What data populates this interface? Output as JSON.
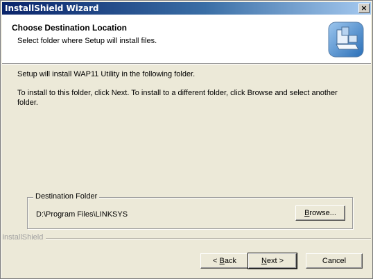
{
  "window": {
    "title": "InstallShield Wizard",
    "close_label": "×"
  },
  "header": {
    "title": "Choose Destination Location",
    "subtitle": "Select folder where Setup will install files.",
    "icon": "setup-computer-icon"
  },
  "body": {
    "line1": "Setup will install WAP11 Utility in the following folder.",
    "line2": "To install to this folder, click Next. To install to a different folder, click Browse and select another folder."
  },
  "destination": {
    "legend": "Destination Folder",
    "path": "D:\\Program Files\\LINKSYS",
    "browse_mnemonic": "B",
    "browse_rest": "rowse..."
  },
  "footer": {
    "brand": "InstallShield",
    "back_prefix": "< ",
    "back_mnemonic": "B",
    "back_rest": "ack",
    "next_mnemonic": "N",
    "next_rest": "ext >",
    "cancel": "Cancel"
  }
}
